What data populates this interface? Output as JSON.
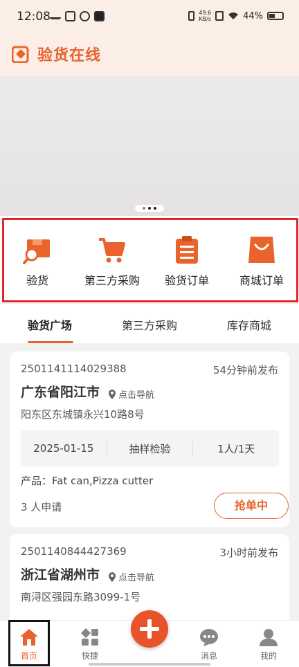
{
  "status_bar": {
    "time": "12:08",
    "speed_top": "49.6",
    "speed_unit": "KB/s",
    "battery": "44%"
  },
  "header": {
    "title": "验货在线"
  },
  "quick_menu": [
    {
      "label": "验货",
      "icon": "box-search-icon"
    },
    {
      "label": "第三方采购",
      "icon": "cart-icon"
    },
    {
      "label": "验货订单",
      "icon": "clipboard-icon"
    },
    {
      "label": "商城订单",
      "icon": "shopping-bag-icon"
    }
  ],
  "tabs": [
    {
      "label": "验货广场",
      "active": true
    },
    {
      "label": "第三方采购",
      "active": false
    },
    {
      "label": "库存商城",
      "active": false
    }
  ],
  "orders": [
    {
      "order_no": "2501141114029388",
      "posted": "54分钟前发布",
      "city": "广东省阳江市",
      "nav_label": "点击导航",
      "address": "阳东区东城镇永兴10路8号",
      "date": "2025-01-15",
      "method": "抽样检验",
      "staffing": "1人/1天",
      "product": "产品：Fat can,Pizza cutter",
      "applicants": "3 人申请",
      "grab_label": "抢单中"
    },
    {
      "order_no": "2501140844427369",
      "posted": "3小时前发布",
      "city": "浙江省湖州市",
      "nav_label": "点击导航",
      "address": "南浔区强园东路3099-1号"
    }
  ],
  "bottom_nav": [
    {
      "label": "首页",
      "icon": "home-icon",
      "active": true
    },
    {
      "label": "快捷",
      "icon": "grid-icon",
      "active": false
    },
    {
      "label": "消息",
      "icon": "chat-icon",
      "active": false
    },
    {
      "label": "我的",
      "icon": "user-icon",
      "active": false
    }
  ],
  "colors": {
    "accent": "#e8642c",
    "highlight_frame": "#e4262b",
    "header_bg": "#fbeee6"
  }
}
